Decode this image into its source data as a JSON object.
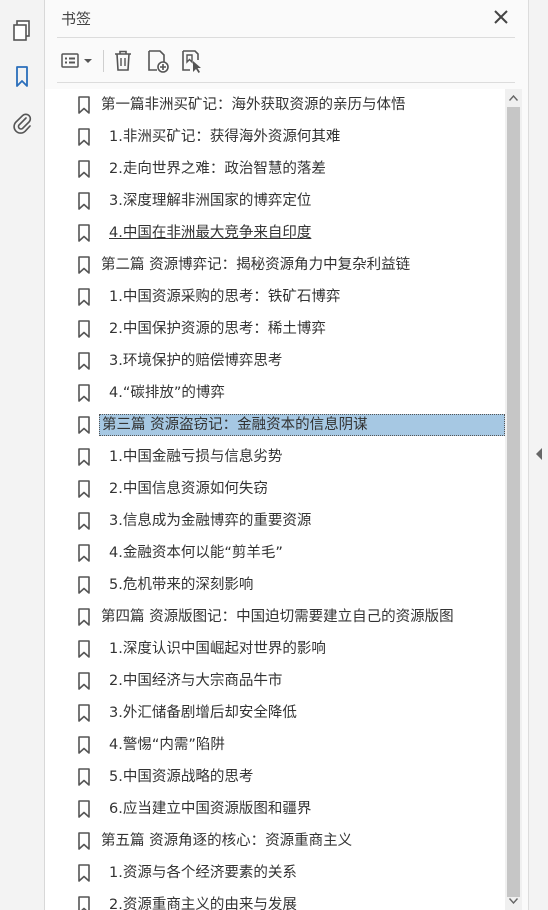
{
  "panel": {
    "title": "书签"
  },
  "rail": {
    "icons": [
      "pages-icon",
      "bookmark-icon",
      "attachment-icon"
    ]
  },
  "toolbar": {
    "buttons": [
      "options-menu-icon",
      "delete-bookmark-icon",
      "new-bookmark-icon",
      "new-bookmark-from-structure-icon"
    ]
  },
  "colors": {
    "selection": "#a6c8e3",
    "active_icon": "#2a6ebb",
    "text": "#333333"
  },
  "bookmarks": [
    {
      "label": "第一篇非洲买矿记：海外获取资源的亲历与体悟",
      "level": 0
    },
    {
      "label": "1.非洲买矿记：获得海外资源何其难",
      "level": 1
    },
    {
      "label": "2.走向世界之难：政治智慧的落差",
      "level": 1
    },
    {
      "label": "3.深度理解非洲国家的博弈定位",
      "level": 1
    },
    {
      "label": "4.中国在非洲最大竞争来自印度",
      "level": 1,
      "underlined": true
    },
    {
      "label": "第二篇  资源博弈记：揭秘资源角力中复杂利益链",
      "level": 0
    },
    {
      "label": "1.中国资源采购的思考：铁矿石博弈",
      "level": 1
    },
    {
      "label": "2.中国保护资源的思考：稀土博弈",
      "level": 1
    },
    {
      "label": "3.环境保护的赔偿博弈思考",
      "level": 1
    },
    {
      "label": "4.“碳排放”的博弈",
      "level": 1
    },
    {
      "label": "第三篇  资源盗窃记：金融资本的信息阴谋",
      "level": 0,
      "selected": true
    },
    {
      "label": "1.中国金融亏损与信息劣势",
      "level": 1
    },
    {
      "label": "2.中国信息资源如何失窃",
      "level": 1
    },
    {
      "label": "3.信息成为金融博弈的重要资源",
      "level": 1
    },
    {
      "label": "4.金融资本何以能“剪羊毛”",
      "level": 1
    },
    {
      "label": "5.危机带来的深刻影响",
      "level": 1
    },
    {
      "label": "第四篇  资源版图记：中国迫切需要建立自己的资源版图",
      "level": 0
    },
    {
      "label": "1.深度认识中国崛起对世界的影响",
      "level": 1
    },
    {
      "label": "2.中国经济与大宗商品牛市",
      "level": 1
    },
    {
      "label": "3.外汇储备剧增后却安全降低",
      "level": 1
    },
    {
      "label": "4.警惕“内需”陷阱",
      "level": 1
    },
    {
      "label": "5.中国资源战略的思考",
      "level": 1
    },
    {
      "label": "6.应当建立中国资源版图和疆界",
      "level": 1
    },
    {
      "label": "第五篇  资源角逐的核心：资源重商主义",
      "level": 0
    },
    {
      "label": "1.资源与各个经济要素的关系",
      "level": 1
    },
    {
      "label": "2.资源重商主义的由来与发展",
      "level": 1
    }
  ]
}
